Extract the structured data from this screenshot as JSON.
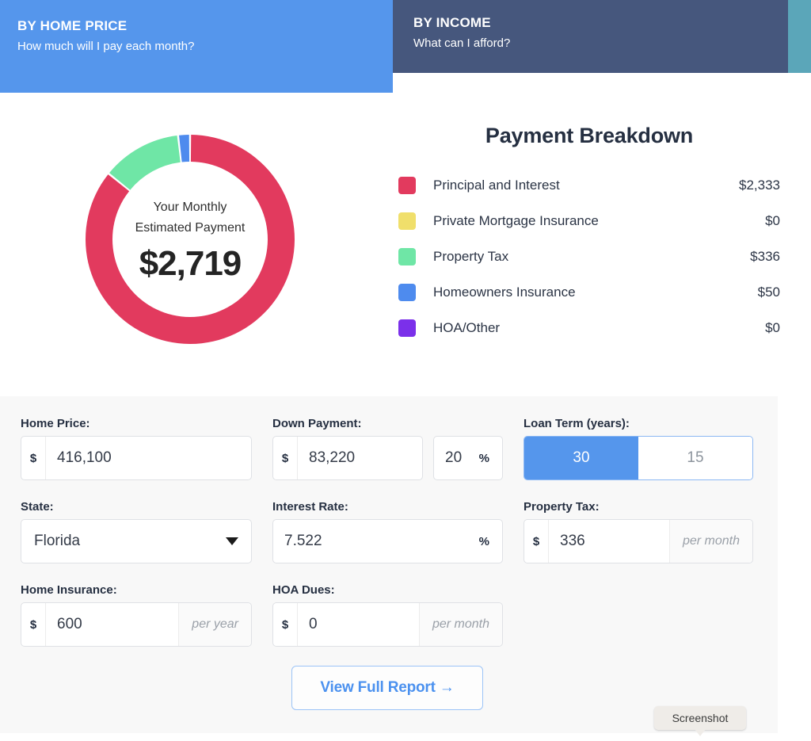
{
  "tabs": [
    {
      "title": "BY HOME PRICE",
      "subtitle": "How much will I pay each month?",
      "state": "active",
      "color": "#5596ec"
    },
    {
      "title": "BY INCOME",
      "subtitle": "What can I afford?",
      "state": "inactive",
      "color": "#46577d"
    }
  ],
  "donut": {
    "label_line1": "Your Monthly",
    "label_line2": "Estimated Payment",
    "amount": "$2,719"
  },
  "breakdown": {
    "title": "Payment Breakdown",
    "rows": [
      {
        "label": "Principal and Interest",
        "value": "$2,333",
        "color": "#e23a5e",
        "amount": 2333
      },
      {
        "label": "Private Mortgage Insurance",
        "value": "$0",
        "color": "#f0df6b",
        "amount": 0
      },
      {
        "label": "Property Tax",
        "value": "$336",
        "color": "#6fe6a6",
        "amount": 336
      },
      {
        "label": "Homeowners Insurance",
        "value": "$50",
        "color": "#4e8bee",
        "amount": 50
      },
      {
        "label": "HOA/Other",
        "value": "$0",
        "color": "#7b30ea",
        "amount": 0
      }
    ]
  },
  "chart_data": {
    "type": "pie",
    "title": "Payment Breakdown",
    "categories": [
      "Principal and Interest",
      "Private Mortgage Insurance",
      "Property Tax",
      "Homeowners Insurance",
      "HOA/Other"
    ],
    "values": [
      2333,
      0,
      336,
      50,
      0
    ],
    "colors": [
      "#e23a5e",
      "#f0df6b",
      "#6fe6a6",
      "#4e8bee",
      "#7b30ea"
    ],
    "total": 2719,
    "center_label": "Your Monthly Estimated Payment",
    "center_value": "$2,719",
    "legend": "right",
    "donut": true
  },
  "form": {
    "home_price": {
      "label": "Home Price:",
      "prefix": "$",
      "value": "416,100"
    },
    "down_payment": {
      "label": "Down Payment:",
      "prefix": "$",
      "value": "83,220",
      "percent_value": "20",
      "percent_unit": "%"
    },
    "loan_term": {
      "label": "Loan Term (years):",
      "options": [
        "30",
        "15"
      ],
      "selected": "30"
    },
    "state": {
      "label": "State:",
      "value": "Florida"
    },
    "interest_rate": {
      "label": "Interest Rate:",
      "value": "7.522",
      "unit": "%"
    },
    "property_tax": {
      "label": "Property Tax:",
      "prefix": "$",
      "value": "336",
      "note": "per month"
    },
    "home_insurance": {
      "label": "Home Insurance:",
      "prefix": "$",
      "value": "600",
      "note": "per year"
    },
    "hoa_dues": {
      "label": "HOA Dues:",
      "prefix": "$",
      "value": "0",
      "note": "per month"
    }
  },
  "report_button": {
    "label": "View Full Report →"
  },
  "tooltip": {
    "label": "Screenshot"
  }
}
